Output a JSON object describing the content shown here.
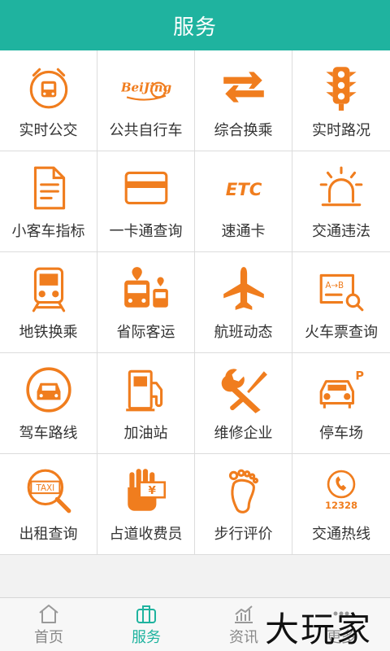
{
  "header": {
    "title": "服务"
  },
  "colors": {
    "accent": "#1fb39f",
    "icon": "#f07d1e"
  },
  "services": [
    {
      "label": "实时公交",
      "icon": "alarm-bus-icon"
    },
    {
      "label": "公共自行车",
      "icon": "beijing-bike-icon"
    },
    {
      "label": "综合换乘",
      "icon": "transfer-arrows-icon"
    },
    {
      "label": "实时路况",
      "icon": "traffic-light-icon"
    },
    {
      "label": "小客车指标",
      "icon": "document-icon"
    },
    {
      "label": "一卡通查询",
      "icon": "card-icon"
    },
    {
      "label": "速通卡",
      "icon": "etc-icon"
    },
    {
      "label": "交通违法",
      "icon": "siren-icon"
    },
    {
      "label": "地铁换乘",
      "icon": "subway-icon"
    },
    {
      "label": "省际客运",
      "icon": "coach-bus-icon"
    },
    {
      "label": "航班动态",
      "icon": "airplane-icon"
    },
    {
      "label": "火车票查询",
      "icon": "ticket-search-icon"
    },
    {
      "label": "驾车路线",
      "icon": "car-route-icon"
    },
    {
      "label": "加油站",
      "icon": "gas-station-icon"
    },
    {
      "label": "维修企业",
      "icon": "repair-tools-icon"
    },
    {
      "label": "停车场",
      "icon": "parking-icon"
    },
    {
      "label": "出租查询",
      "icon": "taxi-search-icon"
    },
    {
      "label": "占道收费员",
      "icon": "toll-collector-icon"
    },
    {
      "label": "步行评价",
      "icon": "footprint-icon"
    },
    {
      "label": "交通热线",
      "icon": "hotline-icon"
    }
  ],
  "icon_text": {
    "beijing": "BeiJing",
    "etc": "ETC",
    "ticket_route": "A→B",
    "parking": "P",
    "taxi": "TAXI",
    "toll": "¥",
    "hotline": "12328"
  },
  "tabs": [
    {
      "label": "首页",
      "icon": "home-icon",
      "active": false
    },
    {
      "label": "服务",
      "icon": "briefcase-icon",
      "active": true
    },
    {
      "label": "资讯",
      "icon": "chart-icon",
      "active": false
    },
    {
      "label": "更多",
      "icon": "more-icon",
      "active": false
    }
  ],
  "watermark": "大玩家"
}
